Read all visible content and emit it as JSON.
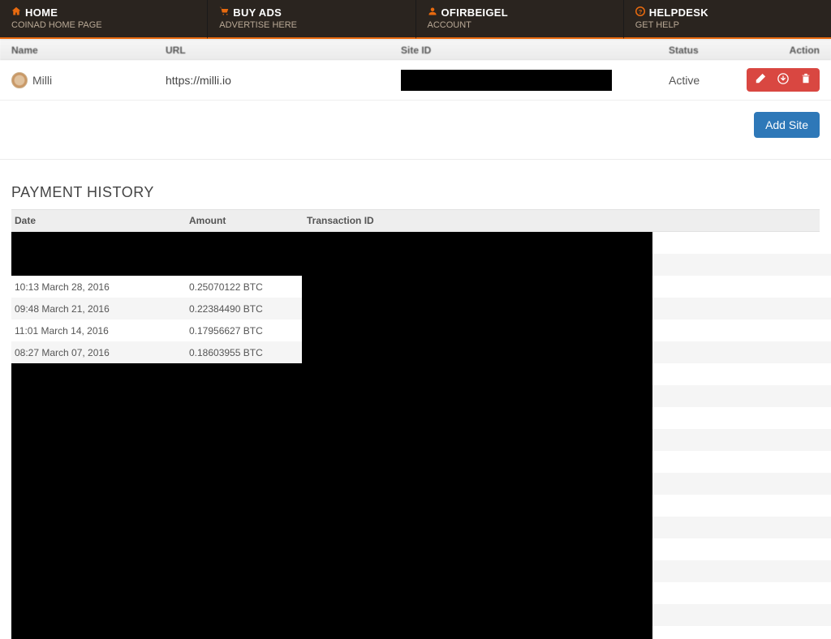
{
  "nav": [
    {
      "icon": "home",
      "title": "HOME",
      "subtitle": "COINAD HOME PAGE"
    },
    {
      "icon": "cart",
      "title": "BUY ADS",
      "subtitle": "ADVERTISE HERE"
    },
    {
      "icon": "user",
      "title": "OFIRBEIGEL",
      "subtitle": "ACCOUNT"
    },
    {
      "icon": "help",
      "title": "HELPDESK",
      "subtitle": "GET HELP"
    }
  ],
  "sites_table": {
    "columns": {
      "name": "Name",
      "url": "URL",
      "siteid": "Site ID",
      "status": "Status",
      "action": "Action"
    }
  },
  "site": {
    "name": "Milli",
    "url": "https://milli.io",
    "status": "Active"
  },
  "buttons": {
    "add_site": "Add Site"
  },
  "history": {
    "title": "PAYMENT HISTORY",
    "columns": {
      "date": "Date",
      "amount": "Amount",
      "txid": "Transaction ID"
    },
    "rows": [
      {
        "date": "",
        "amount": ""
      },
      {
        "date": "",
        "amount": ""
      },
      {
        "date": "10:13 March 28, 2016",
        "amount": "0.25070122 BTC"
      },
      {
        "date": "09:48 March 21, 2016",
        "amount": "0.22384490 BTC"
      },
      {
        "date": "11:01 March 14, 2016",
        "amount": "0.17956627 BTC"
      },
      {
        "date": "08:27 March 07, 2016",
        "amount": "0.18603955 BTC"
      }
    ]
  }
}
